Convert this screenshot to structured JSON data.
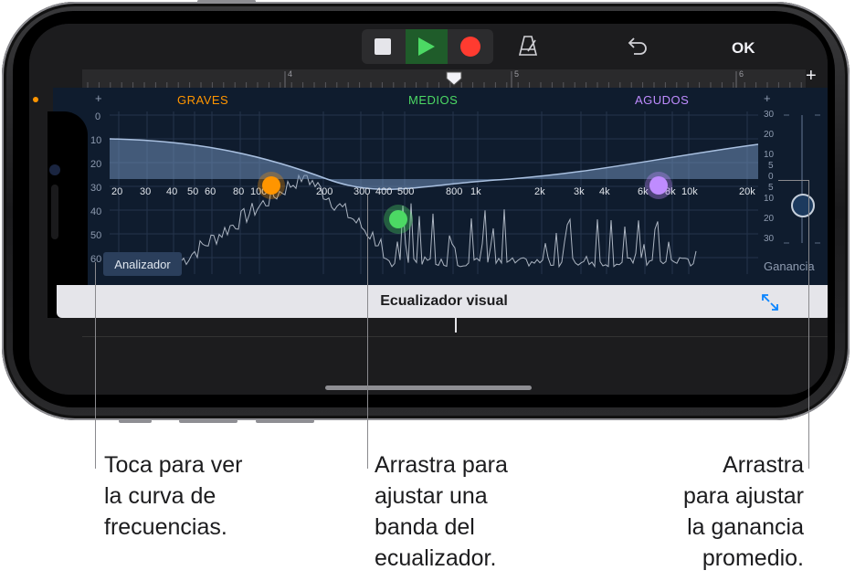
{
  "toolbar": {
    "ok_label": "OK"
  },
  "ruler": {
    "markers": [
      "4",
      "5",
      "6"
    ]
  },
  "eq": {
    "bands": [
      {
        "label": "GRAVES",
        "color": "#ff9500"
      },
      {
        "label": "MEDIOS",
        "color": "#4cd964"
      },
      {
        "label": "AGUDOS",
        "color": "#bf8cff"
      }
    ],
    "plus": "+",
    "analyzer_scale": [
      "0",
      "10",
      "20",
      "30",
      "40",
      "50",
      "60"
    ],
    "frequencies": [
      "20",
      "30",
      "40",
      "50",
      "60",
      "80",
      "100",
      "200",
      "300",
      "400",
      "500",
      "800",
      "1k",
      "2k",
      "3k",
      "4k",
      "6k",
      "8k",
      "10k",
      "20k"
    ],
    "gain_scale": [
      "30",
      "20",
      "10",
      "5",
      "0",
      "5",
      "10",
      "20",
      "30"
    ],
    "analyzer_button": "Analizador",
    "gain_label": "Ganancia",
    "title": "Ecualizador visual"
  },
  "callouts": {
    "left": [
      "Toca para ver",
      "la curva de",
      "frecuencias."
    ],
    "middle": [
      "Arrastra para",
      "ajustar una",
      "banda del",
      "ecualizador."
    ],
    "right": [
      "Arrastra",
      "para ajustar",
      "la ganancia",
      "promedio."
    ]
  }
}
